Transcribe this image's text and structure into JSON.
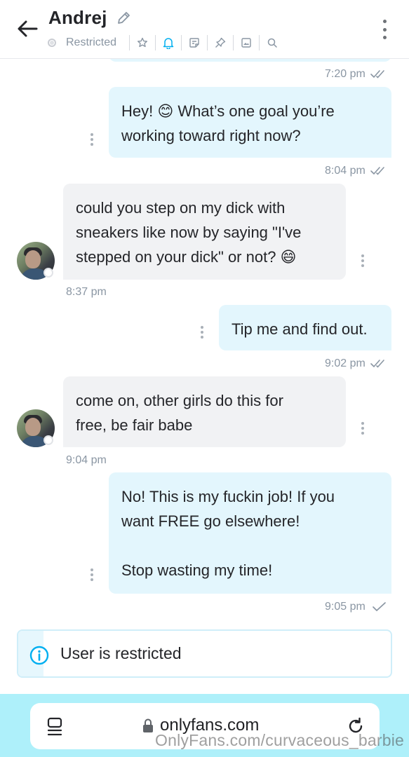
{
  "header": {
    "contact_name": "Andrej",
    "status": "Restricted",
    "tools": [
      "star-icon",
      "bell-icon",
      "note-icon",
      "pin-icon",
      "media-icon",
      "search-icon"
    ]
  },
  "messages": [
    {
      "id": "m1",
      "direction": "outgoing",
      "text": "Hey! 😊 What’s one goal you’re\nworking toward right now?",
      "time": "8:04 pm",
      "read": true
    },
    {
      "id": "m2",
      "direction": "incoming",
      "text": "could you step on my dick with\nsneakers like now by saying \"I've\nstepped on your dick\" or not? 😄",
      "time": "8:37 pm"
    },
    {
      "id": "m3",
      "direction": "outgoing",
      "text": "Tip me and find out.",
      "time": "9:02 pm",
      "read": true
    },
    {
      "id": "m4",
      "direction": "incoming",
      "text": "come on, other girls do this for\nfree, be fair babe",
      "time": "9:04 pm"
    },
    {
      "id": "m5",
      "direction": "outgoing",
      "text": "No! This is my fuckin job! If you\nwant FREE go elsewhere!\n\nStop wasting my time!",
      "time": "9:05 pm",
      "read": false
    }
  ],
  "previous_message_time": "7:20 pm",
  "notice": {
    "text": "User is restricted"
  },
  "browser": {
    "url": "onlyfans.com"
  },
  "watermark": "OnlyFans.com/curvaceous_barbie",
  "colors": {
    "outgoing_bubble": "#e3f6fd",
    "incoming_bubble": "#f1f2f4",
    "accent": "#00aff0",
    "browser_bar": "#aef0fa"
  }
}
